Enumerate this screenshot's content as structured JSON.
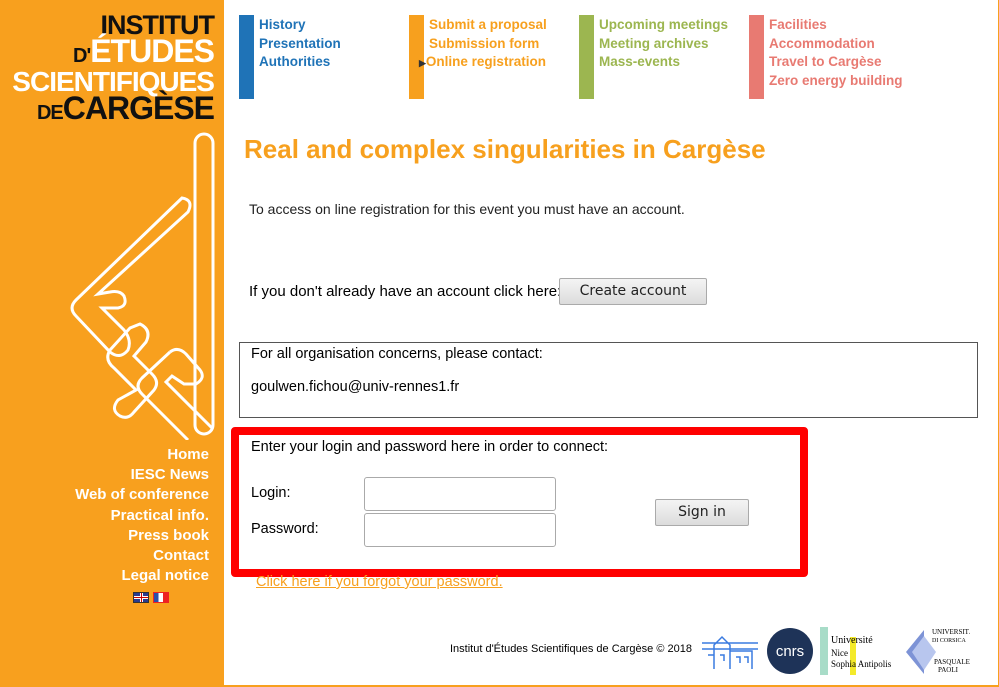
{
  "logo": {
    "line1": "INSTITUT",
    "line2_prefix": "D'",
    "line2": "ÉTUDES",
    "line3": "SCIENTIFIQUES",
    "line4_prefix": "DE",
    "line4": "CARGÈSE"
  },
  "sidebar": {
    "items": [
      {
        "label": "Home"
      },
      {
        "label": "IESC News"
      },
      {
        "label": "Web of conference"
      },
      {
        "label": "Practical info."
      },
      {
        "label": "Press book"
      },
      {
        "label": "Contact"
      },
      {
        "label": "Legal notice"
      }
    ],
    "languages": [
      "en",
      "fr"
    ]
  },
  "topnav": [
    {
      "color": "#1f73b7",
      "links": [
        "History",
        "Presentation",
        "Authorities"
      ]
    },
    {
      "color": "#f7a01e",
      "links": [
        "Submit a proposal",
        "Submission form",
        "Online registration"
      ],
      "active": "Online registration"
    },
    {
      "color": "#9cb650",
      "links": [
        "Upcoming meetings",
        "Meeting archives",
        "Mass-events"
      ]
    },
    {
      "color": "#e87a72",
      "links": [
        "Facilities",
        "Accommodation",
        "Travel to Cargèse",
        "Zero energy building"
      ]
    }
  ],
  "main": {
    "title": "Real and complex singularities in Cargèse",
    "intro": "To access on line registration for this event you must have an account.",
    "create_prompt": "If you don't already have an account click here:",
    "create_label": "Create account",
    "contact_title": "For all organisation concerns, please contact:",
    "contact_email": "goulwen.fichou@univ-rennes1.fr",
    "login_title": "Enter your login and password here in order to connect:",
    "login_label": "Login:",
    "login_value": "",
    "password_label": "Password:",
    "password_value": "",
    "signin_label": "Sign in",
    "forgot": "Click here if you forgot your password."
  },
  "footer": {
    "copyright": "Institut d'Études Scientifiques de Cargèse © 2018",
    "partners": [
      "IESC",
      "cnrs",
      "Université Nice Sophia Antipolis",
      "Università di Corsica Pasquale Paoli"
    ]
  }
}
